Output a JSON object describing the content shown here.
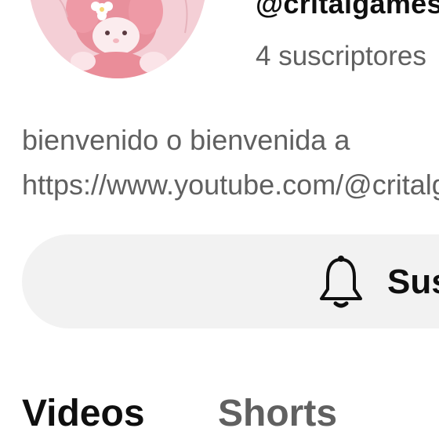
{
  "channel": {
    "handle": "@critalgames",
    "subscribers": "4 suscriptores",
    "description_lines": [
      "bienvenido o bienvenida a",
      "https://www.youtube.com/@critalgames"
    ]
  },
  "subscribe_button": {
    "label": "Suscribirse",
    "icon": "bell-icon"
  },
  "tabs": [
    {
      "label": "Videos",
      "active": true
    },
    {
      "label": "Shorts",
      "active": false
    }
  ],
  "colors": {
    "primary_text": "#0f0f0f",
    "secondary_text": "#606060",
    "button_bg": "#f2f2f2",
    "avatar_bg": "#f4cfd6"
  }
}
